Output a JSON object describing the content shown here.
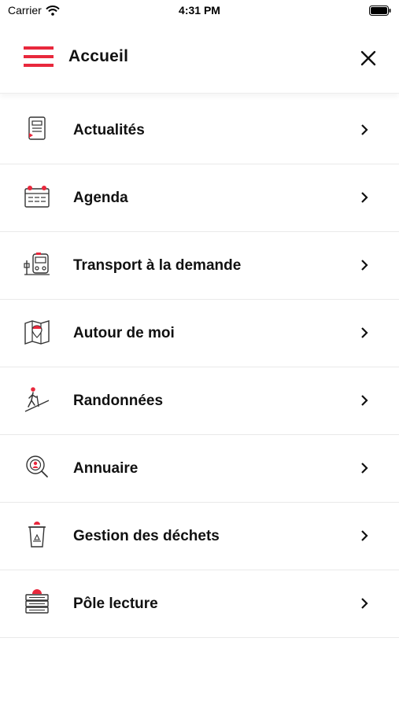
{
  "status_bar": {
    "carrier": "Carrier",
    "time": "4:31 PM"
  },
  "header": {
    "title": "Accueil",
    "menu_icon": "hamburger-icon",
    "close_icon": "close-icon"
  },
  "colors": {
    "accent": "#e8283c",
    "text": "#111111",
    "divider": "#e9e9e9"
  },
  "menu": {
    "items": [
      {
        "label": "Actualités",
        "icon": "news-document-icon"
      },
      {
        "label": "Agenda",
        "icon": "calendar-icon"
      },
      {
        "label": "Transport à la demande",
        "icon": "bus-stop-icon"
      },
      {
        "label": "Autour de moi",
        "icon": "map-pin-icon"
      },
      {
        "label": "Randonnées",
        "icon": "hiker-icon"
      },
      {
        "label": "Annuaire",
        "icon": "directory-search-icon"
      },
      {
        "label": "Gestion des déchets",
        "icon": "recycle-bin-icon"
      },
      {
        "label": "Pôle lecture",
        "icon": "books-icon"
      }
    ]
  }
}
